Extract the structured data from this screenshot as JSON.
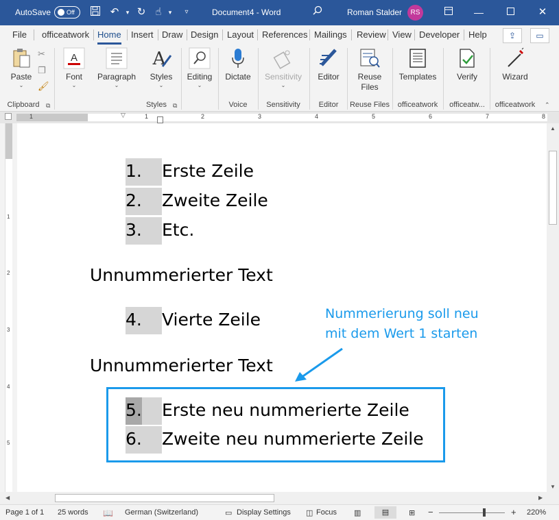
{
  "titlebar": {
    "autosave_label": "AutoSave",
    "autosave_state": "Off",
    "document_title": "Document4  -  Word",
    "user_name": "Roman Stalder",
    "user_initials": "RS"
  },
  "tabs": [
    "File",
    "officeatwork",
    "Home",
    "Insert",
    "Draw",
    "Design",
    "Layout",
    "References",
    "Mailings",
    "Review",
    "View",
    "Developer",
    "Help"
  ],
  "active_tab": "Home",
  "ribbon": {
    "buttons": {
      "paste": "Paste",
      "font": "Font",
      "paragraph": "Paragraph",
      "styles": "Styles",
      "editing": "Editing",
      "dictate": "Dictate",
      "sensitivity": "Sensitivity",
      "editor": "Editor",
      "reuse_files_1": "Reuse",
      "reuse_files_2": "Files",
      "templates": "Templates",
      "verify": "Verify",
      "wizard": "Wizard"
    },
    "groups": {
      "clipboard": "Clipboard",
      "styles": "Styles",
      "voice": "Voice",
      "sensitivity": "Sensitivity",
      "editor": "Editor",
      "reuse_files": "Reuse Files",
      "officeatwork1": "officeatwork",
      "officeatwork2": "officeatw...",
      "officeatwork3": "officeatwork"
    }
  },
  "ruler": {
    "h_numbers": [
      "1",
      "1",
      "2",
      "3",
      "4",
      "5",
      "6",
      "7",
      "8"
    ],
    "v_numbers": [
      "1",
      "2",
      "3",
      "4",
      "5"
    ]
  },
  "document": {
    "list1": [
      {
        "num": "1.",
        "text": "Erste Zeile"
      },
      {
        "num": "2.",
        "text": "Zweite Zeile"
      },
      {
        "num": "3.",
        "text": "Etc."
      }
    ],
    "plain1": "Unnummerierter Text",
    "list2": [
      {
        "num": "4.",
        "text": "Vierte Zeile"
      }
    ],
    "plain2": "Unnummerierter Text",
    "list3": [
      {
        "num": "5.",
        "text": "Erste neu nummerierte Zeile"
      },
      {
        "num": "6.",
        "text": "Zweite neu nummerierte Zeile"
      }
    ],
    "annotation_line1": "Nummerierung soll neu",
    "annotation_line2": "mit dem Wert 1 starten",
    "annotation_color": "#1a9aeb"
  },
  "statusbar": {
    "page": "Page 1 of 1",
    "words": "25 words",
    "language": "German (Switzerland)",
    "display_settings": "Display Settings",
    "focus": "Focus",
    "zoom": "220%"
  },
  "colors": {
    "titlebar": "#2b579a",
    "number_highlight": "#d6d6d6",
    "avatar": "#c2399b"
  }
}
